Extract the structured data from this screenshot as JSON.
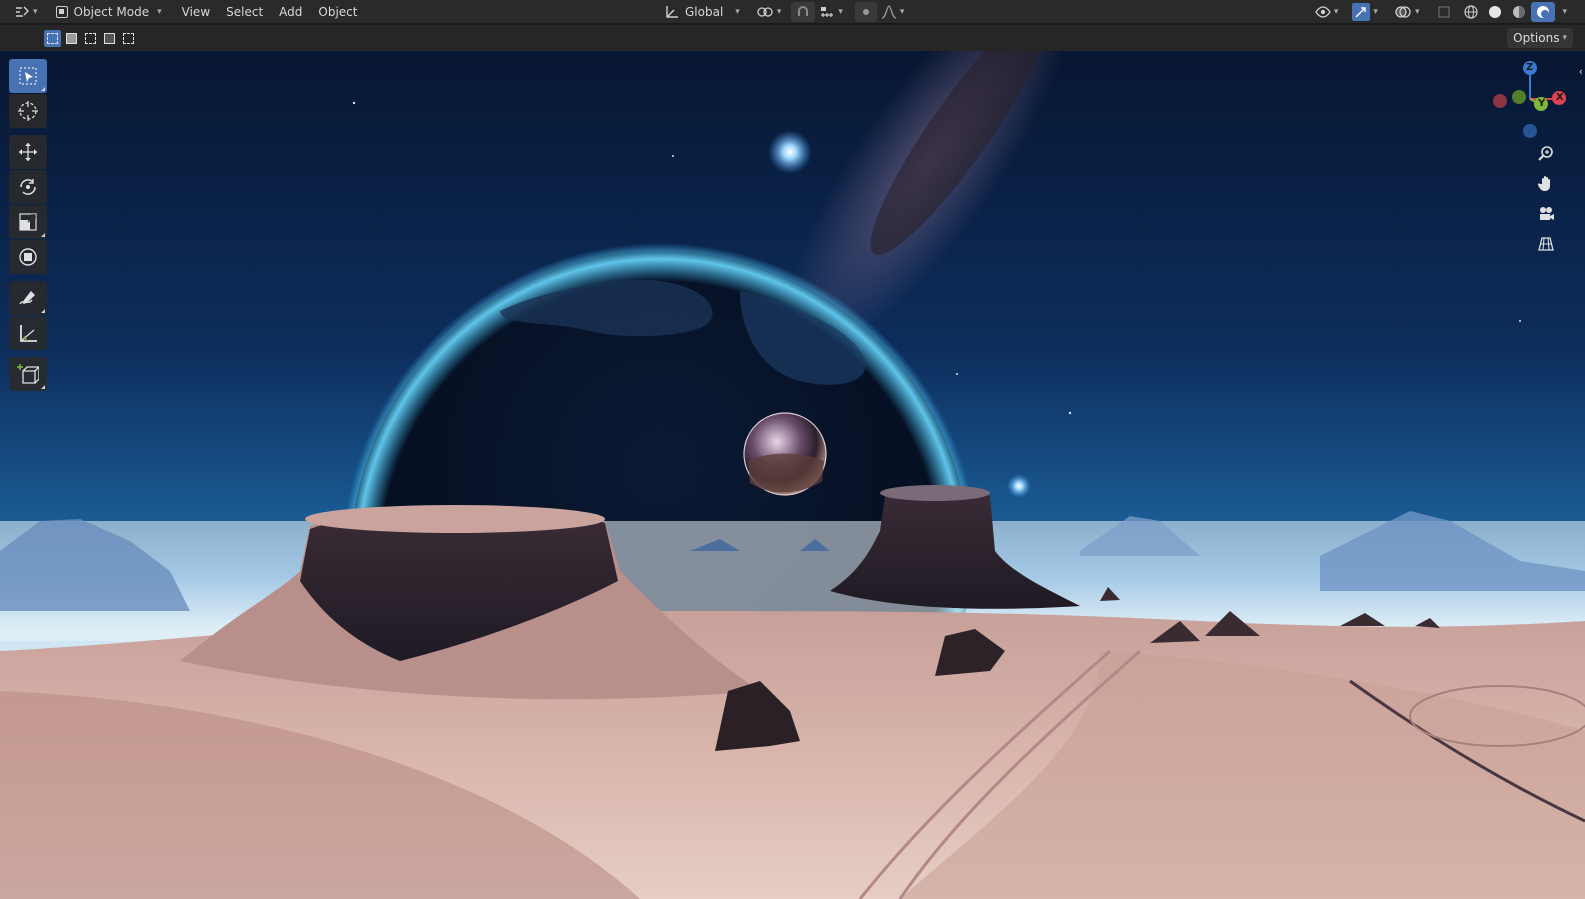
{
  "header": {
    "editor_type_icon": "editor-type-icon",
    "mode_label": "Object Mode",
    "menus": [
      "View",
      "Select",
      "Add",
      "Object"
    ],
    "transform_orientation": "Global"
  },
  "subheader": {
    "options_label": "Options"
  },
  "gizmo": {
    "axis_z": "Z",
    "axis_y": "Y",
    "axis_x": "X",
    "colors": {
      "x": "#e0434f",
      "y": "#7fb93b",
      "z": "#3a78d4"
    }
  },
  "toolbar": {
    "tools": [
      "select-box-icon",
      "cursor-icon",
      "move-icon",
      "rotate-icon",
      "scale-icon",
      "transform-icon",
      "annotate-icon",
      "measure-icon",
      "add-cube-icon"
    ]
  },
  "colors": {
    "accent": "#4772b3",
    "header_bg": "#2a2a2a"
  }
}
